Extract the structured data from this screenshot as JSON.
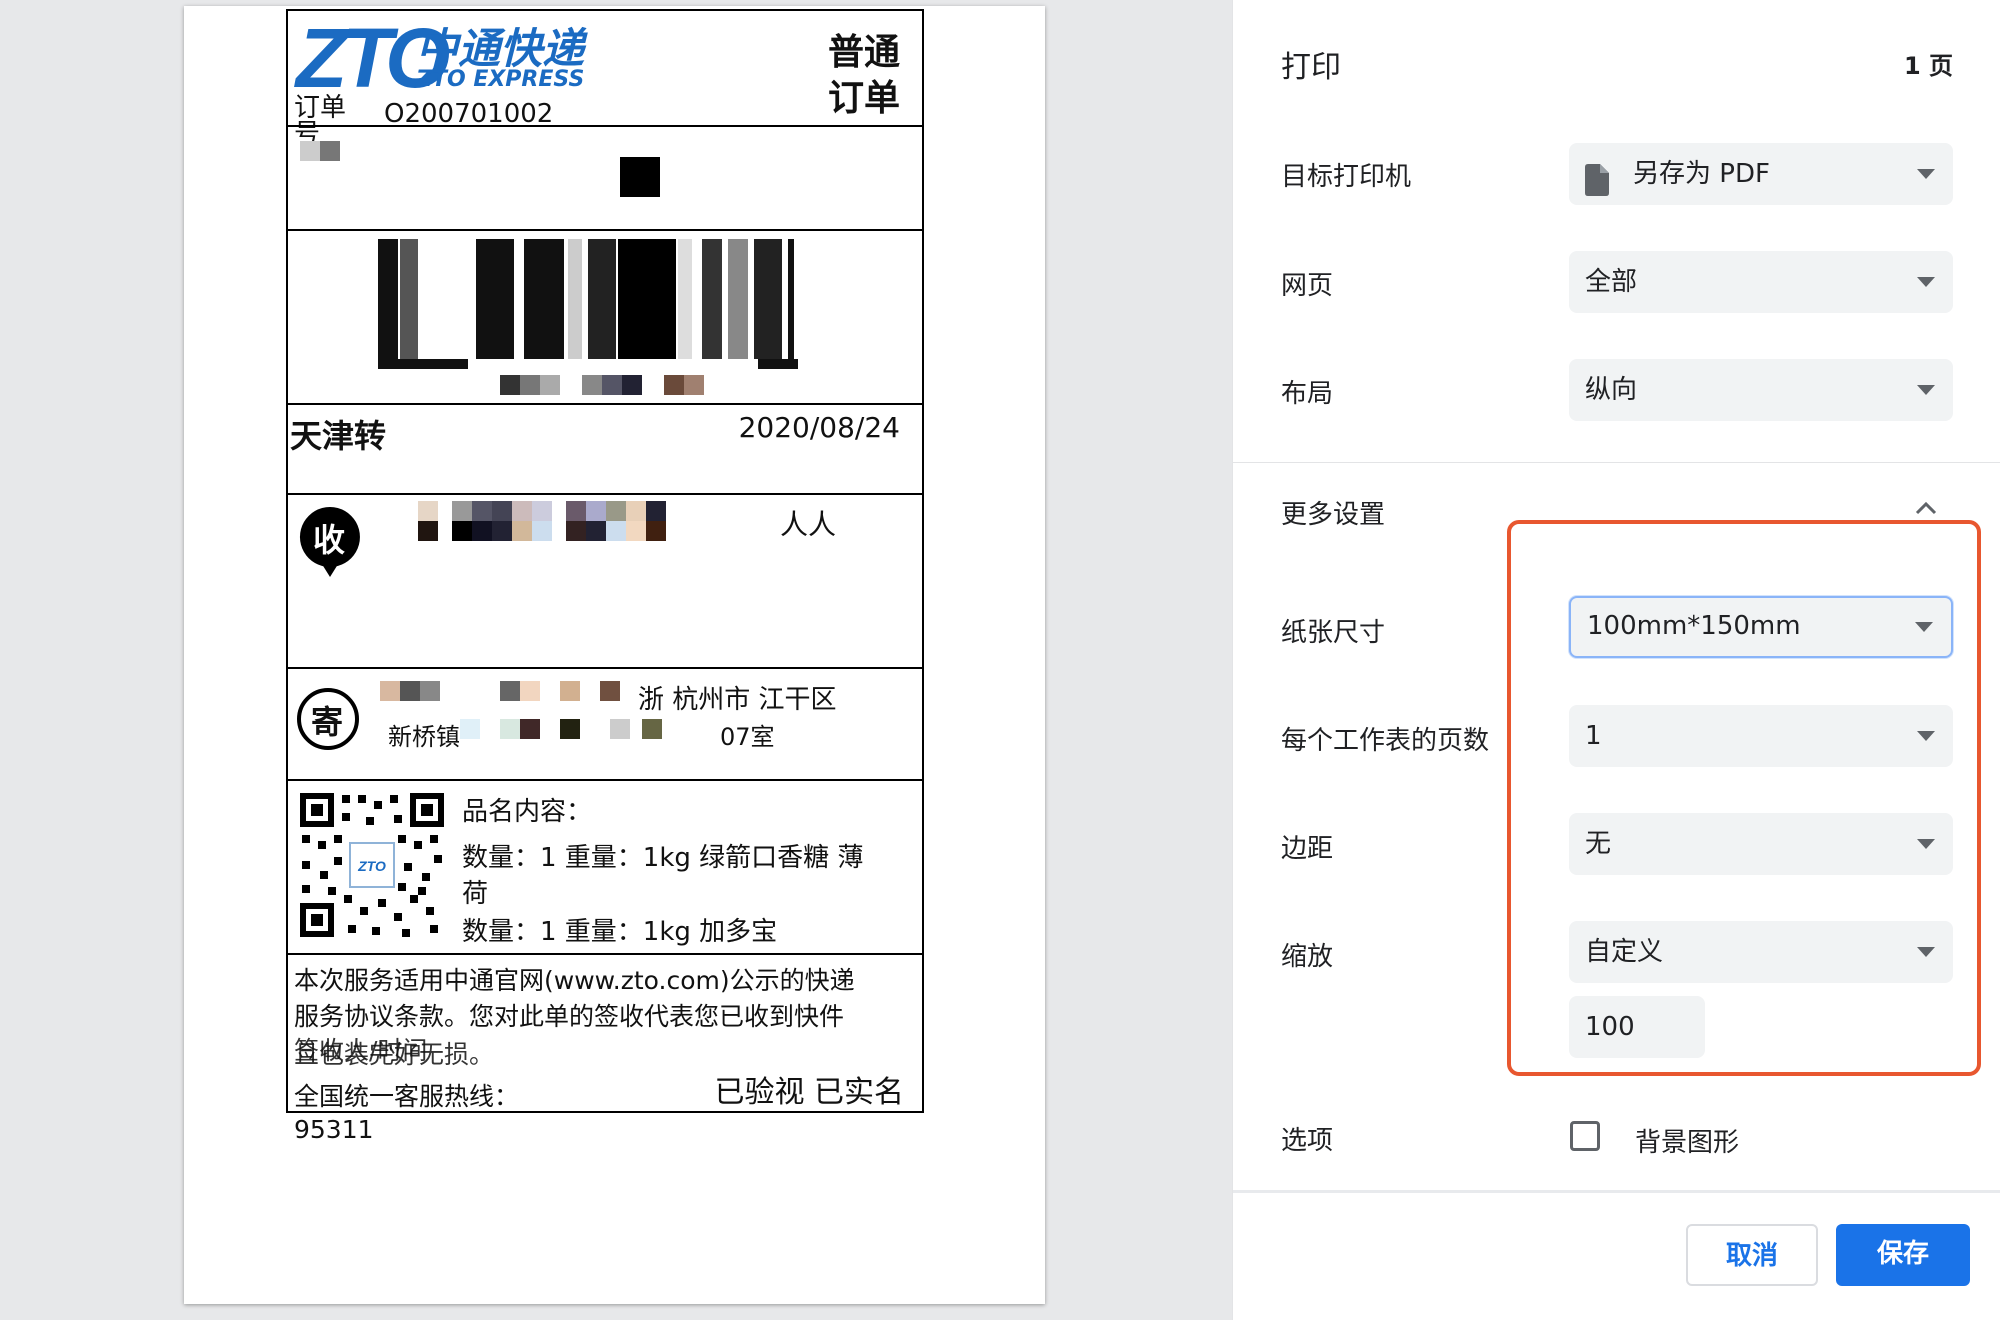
{
  "label": {
    "brand_cn": "中通快递",
    "brand_en": "ZTO EXPRESS",
    "service_type_line1": "普通",
    "service_type_line2": "订单",
    "order_label": "订单号",
    "order_number": "O200701002",
    "transfer_city": "天津转",
    "date": "2020/08/24",
    "receiver_badge": "收",
    "receiver_name_tail": "人人",
    "sender_badge": "寄",
    "sender_address_line1": "浙  杭州市 江干区",
    "sender_address_line2_start": "新桥镇",
    "sender_address_line2_end": "07室",
    "goods_title": "品名内容：",
    "goods_line1": "数量：1  重量：1kg  绿箭口香糖 薄",
    "goods_line1_wrap": "荷",
    "goods_line2": "数量：1  重量：1kg  加多宝",
    "terms_line1": "本次服务适用中通官网(www.zto.com)公示的快递",
    "terms_line2": "服务协议条款。您对此单的签收代表您已收到快件",
    "terms_line3": "且包装完好无损。",
    "terms_overlap": "签收人/时间",
    "verified": "已验视 已实名",
    "hotline_label": "全国统一客服热线：",
    "hotline_number": "95311"
  },
  "print_panel": {
    "title": "打印",
    "page_count": "1 页",
    "destination_label": "目标打印机",
    "destination_value": "另存为 PDF",
    "pages_label": "网页",
    "pages_value": "全部",
    "layout_label": "布局",
    "layout_value": "纵向",
    "more_settings_label": "更多设置",
    "paper_size_label": "纸张尺寸",
    "paper_size_value": "100mm*150mm",
    "pages_per_sheet_label": "每个工作表的页数",
    "pages_per_sheet_value": "1",
    "margins_label": "边距",
    "margins_value": "无",
    "scale_label": "缩放",
    "scale_value": "自定义",
    "scale_input": "100",
    "options_label": "选项",
    "background_graphics_label": "背景图形",
    "cancel_label": "取消",
    "save_label": "保存"
  },
  "colors": {
    "accent": "#1a73e8",
    "highlight_box": "#e8572f",
    "brand_blue": "#1b6bc2"
  },
  "icons": {
    "destination": "document-icon",
    "dropdown": "chevron-down-icon",
    "collapse": "chevron-up-icon"
  }
}
